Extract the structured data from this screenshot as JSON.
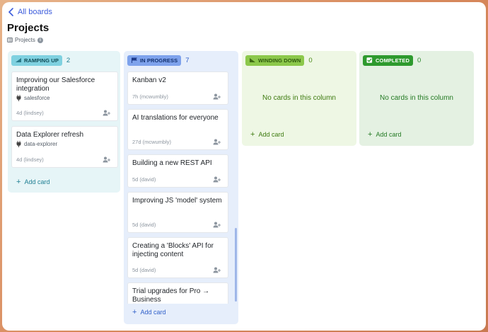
{
  "nav": {
    "back_label": "All boards"
  },
  "page": {
    "title": "Projects",
    "breadcrumb": "Projects"
  },
  "colors": {
    "ramping_bg": "#e6f5f7",
    "ramping_badge": "#7fd1e0",
    "progress_bg": "#e6eefb",
    "progress_badge": "#7ea2ec",
    "winding_bg": "#eef7e4",
    "winding_badge": "#8cc84b",
    "completed_bg": "#e4f1e2",
    "completed_badge": "#2e9a2e",
    "link": "#3b5bdb"
  },
  "columns": {
    "ramping": {
      "label": "RAMPING UP",
      "count": "2",
      "add_label": "Add card",
      "cards": [
        {
          "title": "Improving our Salesforce integration",
          "tag": "salesforce",
          "meta": "4d (lindsey)"
        },
        {
          "title": "Data Explorer refresh",
          "tag": "data-explorer",
          "meta": "4d (lindsey)"
        }
      ]
    },
    "progress": {
      "label": "IN PROGRESS",
      "count": "7",
      "add_label": "Add card",
      "cards": [
        {
          "title": "Kanban v2",
          "meta": "7h (mcwumbly)"
        },
        {
          "title": "AI translations for everyone",
          "meta": "27d (mcwumbly)"
        },
        {
          "title": "Building a new REST API",
          "meta": "5d (david)"
        },
        {
          "title": "Improving JS 'model' system",
          "meta": "5d (david)"
        },
        {
          "title": "Creating a 'Blocks' API for injecting content",
          "meta": "5d (david)"
        },
        {
          "title": "Trial upgrades for Pro → Business"
        }
      ]
    },
    "winding": {
      "label": "WINDING DOWN",
      "count": "0",
      "empty": "No cards in this column",
      "add_label": "Add card"
    },
    "completed": {
      "label": "COMPLETED",
      "count": "0",
      "empty": "No cards in this column",
      "add_label": "Add card"
    }
  }
}
